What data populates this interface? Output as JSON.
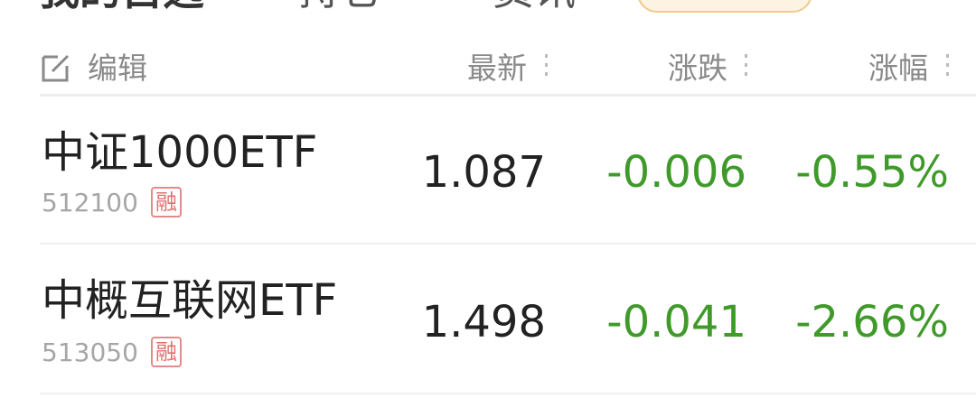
{
  "tabs": {
    "t1": "我的自选",
    "t2": "持仓",
    "t3": "资讯"
  },
  "header": {
    "edit_label": "编辑",
    "col_latest": "最新",
    "col_change": "涨跌",
    "col_pct": "涨幅"
  },
  "rows": [
    {
      "name": "中证1000ETF",
      "code": "512100",
      "badge": "融",
      "latest": "1.087",
      "change": "-0.006",
      "pct": "-0.55%"
    },
    {
      "name": "中概互联网ETF",
      "code": "513050",
      "badge": "融",
      "latest": "1.498",
      "change": "-0.041",
      "pct": "-2.66%"
    }
  ],
  "colors": {
    "down": "#3f9a2a",
    "badge": "#e07070"
  }
}
